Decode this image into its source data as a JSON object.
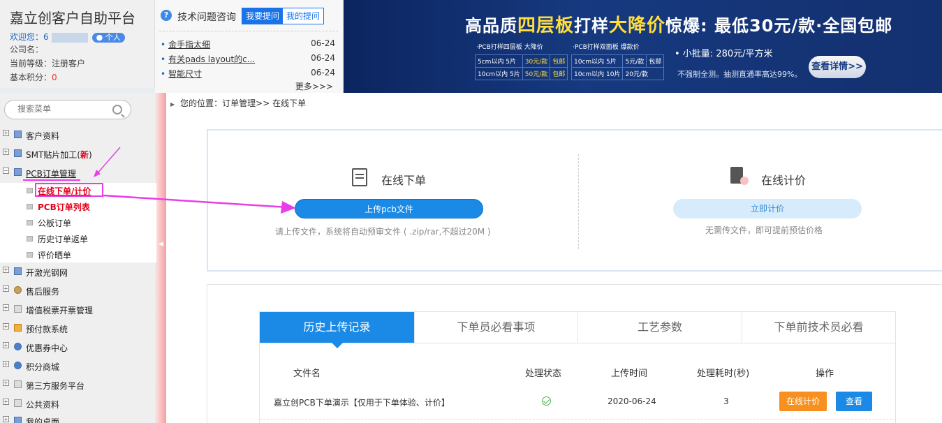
{
  "header": {
    "platform_title": "嘉立创客户自助平台",
    "welcome_label": "欢迎您：6",
    "personal_badge": "个人",
    "company_label": "公司名：",
    "level_label": "当前等级：",
    "level_value": "注册客户",
    "points_label": "基本积分：",
    "points_value": "0"
  },
  "qa": {
    "title": "技术问题咨询",
    "ask_tab": "我要提问",
    "mine_tab": "我的提问",
    "items": [
      {
        "title": "金手指太细",
        "date": "06-24"
      },
      {
        "title": "有关pads layout的c...",
        "date": "06-24"
      },
      {
        "title": "智能尺寸",
        "date": "06-24"
      }
    ],
    "more": "更多>>>"
  },
  "banner": {
    "headline_a": "高品质",
    "headline_b": "四层板",
    "headline_c": "打样",
    "headline_d": "大降价",
    "headline_e": "惊爆: 最低30元/款·全国包邮",
    "table1_caption": "·PCB打样四层板 大降价",
    "table1": [
      [
        "5cm以内 5片",
        "30元/款",
        "包邮"
      ],
      [
        "10cm以内 5片",
        "50元/款",
        "包邮"
      ]
    ],
    "table2_caption": "·PCB打样双面板 爆款价",
    "table2": [
      [
        "10cm以内 5片",
        "5元/款",
        "包邮"
      ],
      [
        "10cm以内 10片",
        "20元/款"
      ]
    ],
    "small_batch": "• 小批量: 280元/平方米",
    "small_note": "不强制全测。抽测直通率高达99%。",
    "details_button": "查看详情>>"
  },
  "sidebar": {
    "search_placeholder": "搜索菜单",
    "items": [
      {
        "label": "客户资料"
      },
      {
        "label": "SMT贴片加工(",
        "tag": "新",
        "close": ")"
      },
      {
        "label": "PCB订单管理"
      },
      {
        "label": "开激光钢网"
      },
      {
        "label": "售后服务"
      },
      {
        "label": "增值税票开票管理"
      },
      {
        "label": "预付款系统"
      },
      {
        "label": "优惠券中心"
      },
      {
        "label": "积分商城"
      },
      {
        "label": "第三方服务平台"
      },
      {
        "label": "公共资料"
      },
      {
        "label": "我的桌面"
      }
    ],
    "sub_items": [
      {
        "label": "在线下单/计价"
      },
      {
        "label": "PCB订单列表"
      },
      {
        "label": "公板订单"
      },
      {
        "label": "历史订单返单"
      },
      {
        "label": "评价晒单"
      }
    ]
  },
  "breadcrumb": "您的位置：订单管理>> 在线下单",
  "order": {
    "online_title": "在线下单",
    "upload_button": "上传pcb文件",
    "upload_note": "请上传文件，系统将自动预审文件 ( .zip/rar,不超过20M )",
    "quote_title": "在线计价",
    "quote_button": "立即计价",
    "quote_note": "无需传文件，即可提前预估价格"
  },
  "tabs": [
    {
      "label": "历史上传记录"
    },
    {
      "label": "下单员必看事项"
    },
    {
      "label": "工艺参数"
    },
    {
      "label": "下单前技术员必看"
    }
  ],
  "table": {
    "headers": [
      "文件名",
      "处理状态",
      "上传时间",
      "处理耗时(秒)",
      "操作"
    ],
    "rows": [
      {
        "filename": "嘉立创PCB下单演示【仅用于下单体验、计价】",
        "uploaded": "2020-06-24",
        "duration": "3",
        "price_action": "在线计价",
        "view_action": "查看"
      }
    ]
  },
  "colors": {
    "primary": "#1a8ae6",
    "orange": "#f7901e",
    "annotation": "#e83ee8",
    "new_tag": "#e3001b"
  }
}
